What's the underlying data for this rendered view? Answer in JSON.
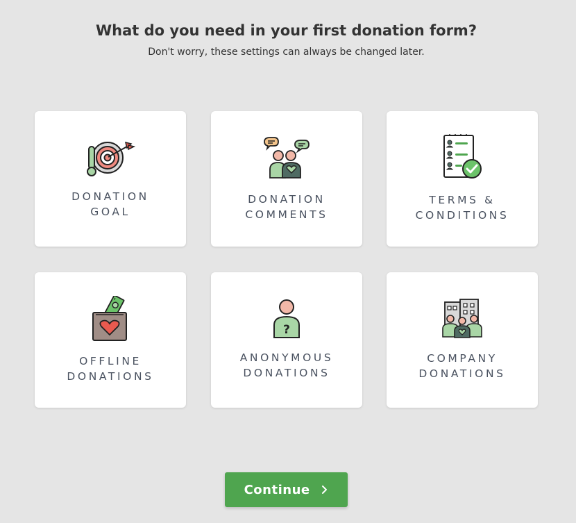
{
  "header": {
    "title": "What do you need in your first donation form?",
    "subtitle": "Don't worry, these settings can always be changed later."
  },
  "options": [
    {
      "line1": "DONATION",
      "line2": "GOAL",
      "icon": "target-thermometer-icon"
    },
    {
      "line1": "DONATION",
      "line2": "COMMENTS",
      "icon": "people-chat-icon"
    },
    {
      "line1": "TERMS &",
      "line2": "CONDITIONS",
      "icon": "checklist-icon"
    },
    {
      "line1": "OFFLINE",
      "line2": "DONATIONS",
      "icon": "cash-box-icon"
    },
    {
      "line1": "ANONYMOUS",
      "line2": "DONATIONS",
      "icon": "anonymous-person-icon"
    },
    {
      "line1": "COMPANY",
      "line2": "DONATIONS",
      "icon": "company-people-icon"
    }
  ],
  "continue_button": {
    "label": "Continue",
    "icon": "chevron-right-icon"
  },
  "colors": {
    "background": "#e5e5e5",
    "card": "#ffffff",
    "accent_green": "#4fa54f",
    "text_dark": "#333333",
    "label_text": "#4a5260"
  }
}
